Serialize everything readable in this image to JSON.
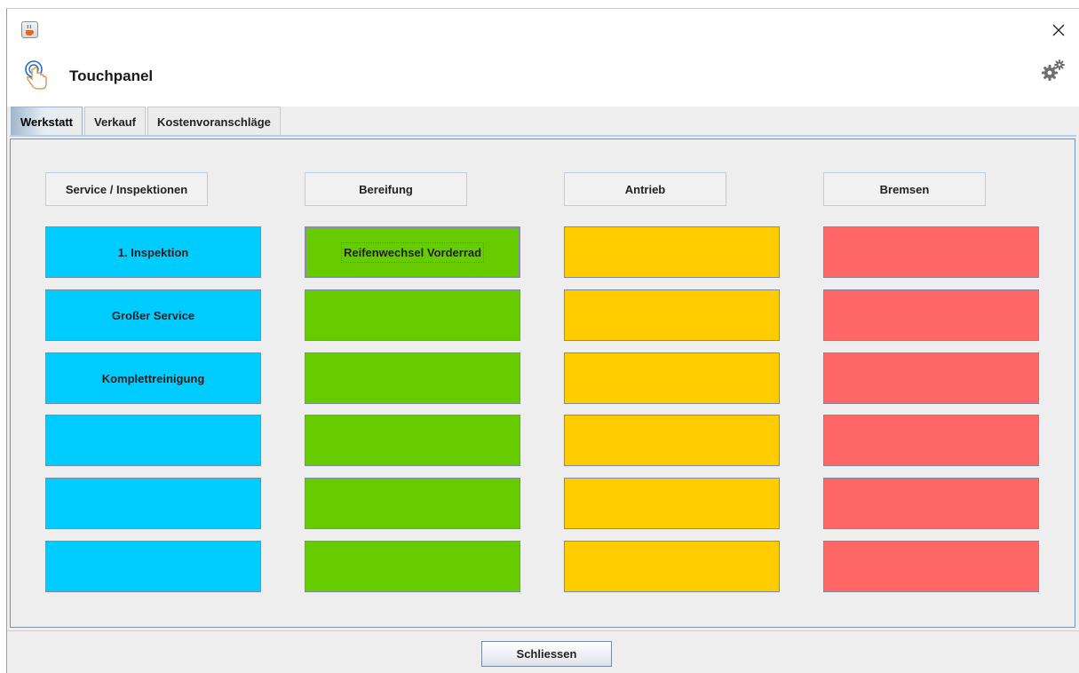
{
  "window": {
    "app_title": "Touchpanel"
  },
  "tabs": [
    {
      "label": "Werkstatt",
      "active": true
    },
    {
      "label": "Verkauf",
      "active": false
    },
    {
      "label": "Kostenvoranschläge",
      "active": false
    }
  ],
  "columns": [
    {
      "header": "Service / Inspektionen",
      "color": "#00ccff",
      "buttons": [
        "1. Inspektion",
        "Großer Service",
        "Komplettreinigung",
        "",
        "",
        ""
      ]
    },
    {
      "header": "Bereifung",
      "color": "#66cc00",
      "buttons": [
        "Reifenwechsel Vorderrad",
        "",
        "",
        "",
        "",
        ""
      ]
    },
    {
      "header": "Antrieb",
      "color": "#ffcc00",
      "buttons": [
        "",
        "",
        "",
        "",
        "",
        ""
      ]
    },
    {
      "header": "Bremsen",
      "color": "#ff6666",
      "buttons": [
        "",
        "",
        "",
        "",
        "",
        ""
      ]
    }
  ],
  "footer": {
    "close_label": "Schliessen"
  },
  "icons": {
    "app": "java-cup-icon",
    "close": "close-icon",
    "header": "touch-hand-icon",
    "settings": "gear-icon"
  }
}
